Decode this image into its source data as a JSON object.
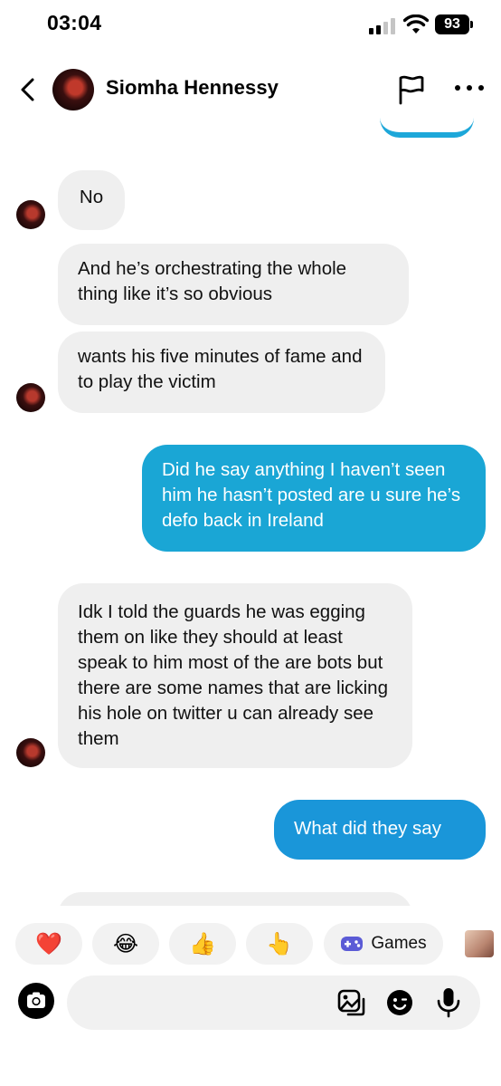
{
  "status_bar": {
    "time": "03:04",
    "battery": "93"
  },
  "header": {
    "contact_name": "Siomha Hennessy"
  },
  "messages": [
    {
      "from": "them",
      "text": "No"
    },
    {
      "from": "them",
      "text": "And he’s orchestrating the whole thing like it’s so obvious"
    },
    {
      "from": "them",
      "text": "wants his five minutes of fame and to play the victim"
    },
    {
      "from": "me",
      "text": "Did he say anything I haven’t seen him he hasn’t posted are u sure he’s defo back in Ireland"
    },
    {
      "from": "them",
      "text": "Idk I told the guards he was egging them on like they should at least speak to him most of the are bots but there are some names that are licking his hole on twitter u can already see them"
    },
    {
      "from": "me",
      "text": "What did they say"
    }
  ],
  "quick_reactions": [
    {
      "emoji": "❤️"
    },
    {
      "emoji": "😂"
    },
    {
      "emoji": "👍"
    },
    {
      "emoji": "👆"
    },
    {
      "label": "Games",
      "icon": "gamepad-icon"
    }
  ],
  "composer": {
    "placeholder": ""
  },
  "colors": {
    "sent_bubble": "#1aa6d5",
    "received_bubble": "#efefef"
  }
}
